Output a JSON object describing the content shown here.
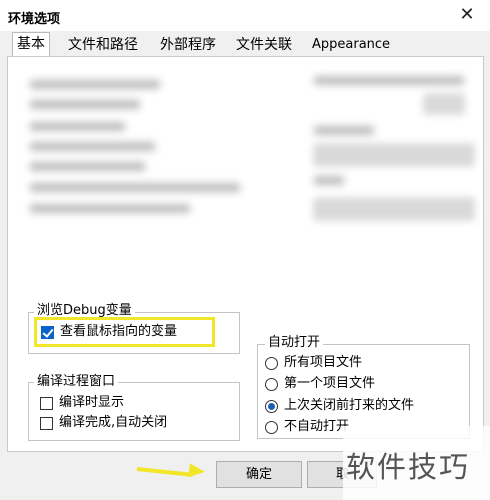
{
  "window": {
    "title": "环境选项",
    "close_glyph": "✕"
  },
  "tabs": [
    {
      "label": "基本",
      "active": true
    },
    {
      "label": "文件和路径",
      "active": false
    },
    {
      "label": "外部程序",
      "active": false
    },
    {
      "label": "文件关联",
      "active": false
    },
    {
      "label": "Appearance",
      "active": false
    }
  ],
  "debug_group": {
    "title": "浏览Debug变量",
    "options": [
      {
        "label": "查看鼠标指向的变量",
        "checked": true
      }
    ]
  },
  "compile_group": {
    "title": "编译过程窗口",
    "options": [
      {
        "label": "编译时显示",
        "checked": false
      },
      {
        "label": "编译完成,自动关闭",
        "checked": false
      }
    ]
  },
  "autoopen_group": {
    "title": "自动打开",
    "options": [
      {
        "label": "所有项目文件",
        "selected": false
      },
      {
        "label": "第一个项目文件",
        "selected": false
      },
      {
        "label": "上次关闭前打来的文件",
        "selected": true
      },
      {
        "label": "不自动打开",
        "selected": false
      }
    ]
  },
  "buttons": {
    "ok": "确定",
    "cancel": "取"
  },
  "watermark": "软件技巧",
  "colors": {
    "highlight": "#f2e628",
    "accent": "#0a64c8"
  }
}
